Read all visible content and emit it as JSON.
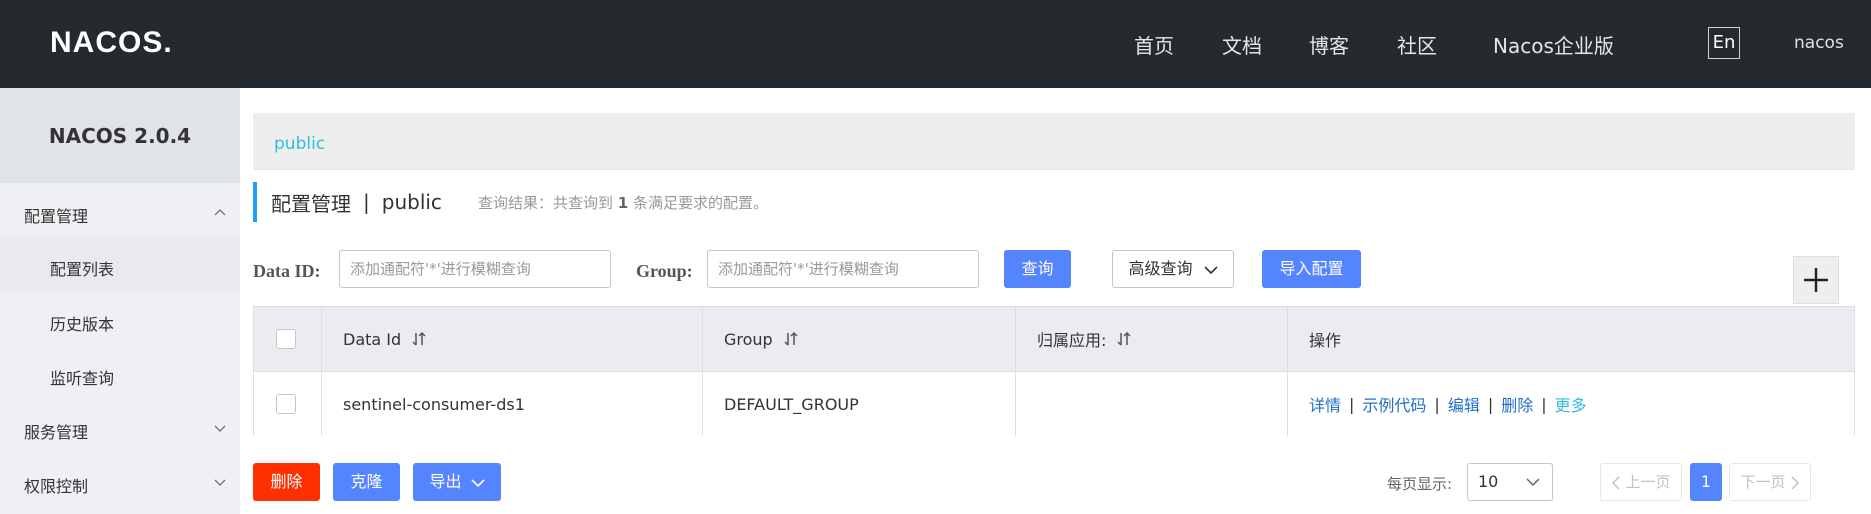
{
  "header": {
    "logo_text": "NACOS.",
    "nav": [
      "首页",
      "文档",
      "博客",
      "社区",
      "Nacos企业版"
    ],
    "lang_button": "En",
    "user": "nacos"
  },
  "sidebar": {
    "version": "NACOS 2.0.4",
    "groups": [
      {
        "label": "配置管理",
        "expanded": true,
        "items": [
          "配置列表",
          "历史版本",
          "监听查询"
        ]
      },
      {
        "label": "服务管理",
        "expanded": false
      },
      {
        "label": "权限控制",
        "expanded": false
      }
    ]
  },
  "namespace": {
    "current": "public"
  },
  "page": {
    "title": "配置管理",
    "separator": "|",
    "namespace": "public",
    "result_prefix": "查询结果：共查询到",
    "result_count": "1",
    "result_suffix": "条满足要求的配置。"
  },
  "search": {
    "data_id_label": "Data ID:",
    "data_id_placeholder": "添加通配符'*'进行模糊查询",
    "group_label": "Group:",
    "group_placeholder": "添加通配符'*'进行模糊查询",
    "query_button": "查询",
    "advanced_button": "高级查询",
    "import_button": "导入配置"
  },
  "table": {
    "columns": [
      "Data Id",
      "Group",
      "归属应用:",
      "操作"
    ],
    "rows": [
      {
        "data_id": "sentinel-consumer-ds1",
        "group": "DEFAULT_GROUP",
        "app": "",
        "ops": [
          "详情",
          "示例代码",
          "编辑",
          "删除",
          "更多"
        ]
      }
    ]
  },
  "footer": {
    "delete_button": "删除",
    "clone_button": "克隆",
    "export_button": "导出",
    "page_size_label": "每页显示:",
    "page_size": "10",
    "prev": "上一页",
    "current_page": "1",
    "next": "下一页"
  },
  "colors": {
    "header_bg": "#252a2f",
    "primary": "#5584ff",
    "danger": "#ff3000",
    "link": "#1f6fc9",
    "namespace_link": "#33bce4"
  }
}
